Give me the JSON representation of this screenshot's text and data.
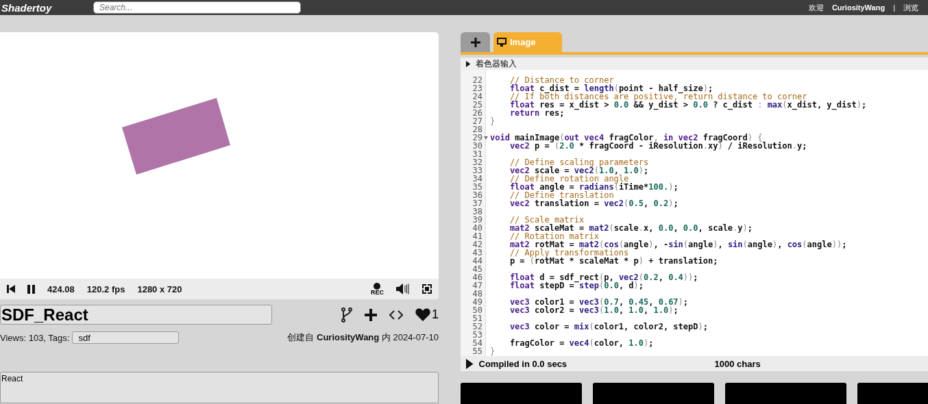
{
  "header": {
    "logo": "Shadertoy",
    "search": {
      "placeholder": "Search..."
    },
    "welcome": "欢迎",
    "user": "CuriosityWang",
    "separator": "|",
    "browse": "浏览"
  },
  "player": {
    "time": "424.08",
    "fps": "120.2 fps",
    "resolution": "1280 x 720",
    "rec": "REC"
  },
  "shader": {
    "title": "SDF_React",
    "views": "Views: 103, Tags:",
    "tags": "sdf",
    "created_prefix": "创建自",
    "author": "CuriosityWang",
    "created_mid": "内",
    "date": "2024-07-10",
    "likes": "1",
    "description": "React"
  },
  "editor": {
    "tabs": [
      {
        "kind": "add",
        "selected": false
      },
      {
        "label": "Image",
        "kind": "image",
        "selected": true
      }
    ],
    "inputs_label": "着色器输入",
    "lines": [
      {
        "n": "22",
        "fold": false,
        "s": [
          {
            "t": "    // Distance to corner",
            "kind": "comment"
          }
        ]
      },
      {
        "n": "23",
        "fold": false,
        "s": [
          {
            "t": "    float",
            "kind": "type"
          },
          {
            "t": " c_dist = ",
            "kind": "plain"
          },
          {
            "t": "length",
            "kind": "func"
          },
          {
            "t": "(",
            "kind": "punct"
          },
          {
            "t": "point - half_size",
            "kind": "plain"
          },
          {
            "t": ")",
            "kind": "punct"
          },
          {
            "t": ";",
            "kind": "plain"
          }
        ]
      },
      {
        "n": "24",
        "fold": false,
        "s": [
          {
            "t": "    // If both distances are positive, return distance to corner",
            "kind": "comment"
          }
        ]
      },
      {
        "n": "25",
        "fold": false,
        "s": [
          {
            "t": "    float",
            "kind": "type"
          },
          {
            "t": " res = x_dist > ",
            "kind": "plain"
          },
          {
            "t": "0.0",
            "kind": "number"
          },
          {
            "t": " && y_dist > ",
            "kind": "plain"
          },
          {
            "t": "0.0",
            "kind": "number"
          },
          {
            "t": " ? c_dist ",
            "kind": "plain"
          },
          {
            "t": ": ",
            "kind": "punct"
          },
          {
            "t": "max",
            "kind": "func"
          },
          {
            "t": "(",
            "kind": "punct"
          },
          {
            "t": "x_dist, y_dist",
            "kind": "plain"
          },
          {
            "t": ")",
            "kind": "punct"
          },
          {
            "t": ";",
            "kind": "plain"
          }
        ]
      },
      {
        "n": "26",
        "fold": false,
        "s": [
          {
            "t": "    return",
            "kind": "type"
          },
          {
            "t": " res;",
            "kind": "plain"
          }
        ]
      },
      {
        "n": "27",
        "fold": false,
        "s": [
          {
            "t": "}",
            "kind": "punct"
          }
        ]
      },
      {
        "n": "28",
        "fold": false
      },
      {
        "n": "29",
        "fold": true,
        "s": [
          {
            "t": "void",
            "kind": "type"
          },
          {
            "t": " mainImage",
            "kind": "plain"
          },
          {
            "t": "(",
            "kind": "punct"
          },
          {
            "t": "out vec4",
            "kind": "type"
          },
          {
            "t": " fragColor",
            "kind": "plain"
          },
          {
            "t": ", ",
            "kind": "punct"
          },
          {
            "t": "in vec2",
            "kind": "type"
          },
          {
            "t": " fragCoord",
            "kind": "plain"
          },
          {
            "t": ")",
            "kind": "punct"
          },
          {
            "t": " {",
            "kind": "punct"
          }
        ]
      },
      {
        "n": "30",
        "fold": false,
        "s": [
          {
            "t": "    vec2",
            "kind": "type"
          },
          {
            "t": " p = ",
            "kind": "plain"
          },
          {
            "t": "(",
            "kind": "punct"
          },
          {
            "t": "2.0",
            "kind": "number"
          },
          {
            "t": " * fragCoord - iResolution",
            "kind": "plain"
          },
          {
            "t": ".",
            "kind": "punct"
          },
          {
            "t": "xy",
            "kind": "plain"
          },
          {
            "t": ")",
            "kind": "punct"
          },
          {
            "t": " / iResolution",
            "kind": "plain"
          },
          {
            "t": ".",
            "kind": "punct"
          },
          {
            "t": "y;",
            "kind": "plain"
          }
        ]
      },
      {
        "n": "31",
        "fold": false
      },
      {
        "n": "32",
        "fold": false,
        "s": [
          {
            "t": "    // Define scaling parameters",
            "kind": "comment"
          }
        ]
      },
      {
        "n": "33",
        "fold": false,
        "s": [
          {
            "t": "    vec2",
            "kind": "type"
          },
          {
            "t": " scale = ",
            "kind": "plain"
          },
          {
            "t": "vec2",
            "kind": "func"
          },
          {
            "t": "(",
            "kind": "punct"
          },
          {
            "t": "1.0",
            "kind": "number"
          },
          {
            "t": ", ",
            "kind": "plain"
          },
          {
            "t": "1.0",
            "kind": "number"
          },
          {
            "t": ")",
            "kind": "punct"
          },
          {
            "t": ";",
            "kind": "plain"
          }
        ]
      },
      {
        "n": "34",
        "fold": false,
        "s": [
          {
            "t": "    // Define rotation angle",
            "kind": "comment"
          }
        ]
      },
      {
        "n": "35",
        "fold": false,
        "s": [
          {
            "t": "    float",
            "kind": "type"
          },
          {
            "t": " angle = ",
            "kind": "plain"
          },
          {
            "t": "radians",
            "kind": "func"
          },
          {
            "t": "(",
            "kind": "punct"
          },
          {
            "t": "iTime*",
            "kind": "plain"
          },
          {
            "t": "100.",
            "kind": "number"
          },
          {
            "t": ")",
            "kind": "punct"
          },
          {
            "t": ";",
            "kind": "plain"
          }
        ]
      },
      {
        "n": "36",
        "fold": false,
        "s": [
          {
            "t": "    // Define translation",
            "kind": "comment"
          }
        ]
      },
      {
        "n": "37",
        "fold": false,
        "s": [
          {
            "t": "    vec2",
            "kind": "type"
          },
          {
            "t": " translation = ",
            "kind": "plain"
          },
          {
            "t": "vec2",
            "kind": "func"
          },
          {
            "t": "(",
            "kind": "punct"
          },
          {
            "t": "0.5",
            "kind": "number"
          },
          {
            "t": ", ",
            "kind": "plain"
          },
          {
            "t": "0.2",
            "kind": "number"
          },
          {
            "t": ")",
            "kind": "punct"
          },
          {
            "t": ";",
            "kind": "plain"
          }
        ]
      },
      {
        "n": "38",
        "fold": false
      },
      {
        "n": "39",
        "fold": false,
        "s": [
          {
            "t": "    // Scale matrix",
            "kind": "comment"
          }
        ]
      },
      {
        "n": "40",
        "fold": false,
        "s": [
          {
            "t": "    mat2",
            "kind": "type"
          },
          {
            "t": " scaleMat = ",
            "kind": "plain"
          },
          {
            "t": "mat2",
            "kind": "func"
          },
          {
            "t": "(",
            "kind": "punct"
          },
          {
            "t": "scale",
            "kind": "plain"
          },
          {
            "t": ".",
            "kind": "punct"
          },
          {
            "t": "x, ",
            "kind": "plain"
          },
          {
            "t": "0.0",
            "kind": "number"
          },
          {
            "t": ", ",
            "kind": "plain"
          },
          {
            "t": "0.0",
            "kind": "number"
          },
          {
            "t": ", scale",
            "kind": "plain"
          },
          {
            "t": ".",
            "kind": "punct"
          },
          {
            "t": "y",
            "kind": "plain"
          },
          {
            "t": ")",
            "kind": "punct"
          },
          {
            "t": ";",
            "kind": "plain"
          }
        ]
      },
      {
        "n": "41",
        "fold": false,
        "s": [
          {
            "t": "    // Rotation matrix",
            "kind": "comment"
          }
        ]
      },
      {
        "n": "42",
        "fold": false,
        "s": [
          {
            "t": "    mat2",
            "kind": "type"
          },
          {
            "t": " rotMat = ",
            "kind": "plain"
          },
          {
            "t": "mat2",
            "kind": "func"
          },
          {
            "t": "(",
            "kind": "punct"
          },
          {
            "t": "cos",
            "kind": "func"
          },
          {
            "t": "(",
            "kind": "punct"
          },
          {
            "t": "angle",
            "kind": "plain"
          },
          {
            "t": ")",
            "kind": "punct"
          },
          {
            "t": ", -",
            "kind": "plain"
          },
          {
            "t": "sin",
            "kind": "func"
          },
          {
            "t": "(",
            "kind": "punct"
          },
          {
            "t": "angle",
            "kind": "plain"
          },
          {
            "t": ")",
            "kind": "punct"
          },
          {
            "t": ", ",
            "kind": "plain"
          },
          {
            "t": "sin",
            "kind": "func"
          },
          {
            "t": "(",
            "kind": "punct"
          },
          {
            "t": "angle",
            "kind": "plain"
          },
          {
            "t": ")",
            "kind": "punct"
          },
          {
            "t": ", ",
            "kind": "plain"
          },
          {
            "t": "cos",
            "kind": "func"
          },
          {
            "t": "(",
            "kind": "punct"
          },
          {
            "t": "angle",
            "kind": "plain"
          },
          {
            "t": "))",
            "kind": "punct"
          },
          {
            "t": ";",
            "kind": "plain"
          }
        ]
      },
      {
        "n": "43",
        "fold": false,
        "s": [
          {
            "t": "    // Apply transformations",
            "kind": "comment"
          }
        ]
      },
      {
        "n": "44",
        "fold": false,
        "s": [
          {
            "t": "    p = ",
            "kind": "plain"
          },
          {
            "t": "(",
            "kind": "punct"
          },
          {
            "t": "rotMat * scaleMat * p",
            "kind": "plain"
          },
          {
            "t": ")",
            "kind": "punct"
          },
          {
            "t": " + translation;",
            "kind": "plain"
          }
        ]
      },
      {
        "n": "45",
        "fold": false
      },
      {
        "n": "46",
        "fold": false,
        "s": [
          {
            "t": "    float",
            "kind": "type"
          },
          {
            "t": " d = sdf_rect",
            "kind": "plain"
          },
          {
            "t": "(",
            "kind": "punct"
          },
          {
            "t": "p, ",
            "kind": "plain"
          },
          {
            "t": "vec2",
            "kind": "func"
          },
          {
            "t": "(",
            "kind": "punct"
          },
          {
            "t": "0.2",
            "kind": "number"
          },
          {
            "t": ", ",
            "kind": "plain"
          },
          {
            "t": "0.4",
            "kind": "number"
          },
          {
            "t": "))",
            "kind": "punct"
          },
          {
            "t": ";",
            "kind": "plain"
          }
        ]
      },
      {
        "n": "47",
        "fold": false,
        "s": [
          {
            "t": "    float",
            "kind": "type"
          },
          {
            "t": " stepD = ",
            "kind": "plain"
          },
          {
            "t": "step",
            "kind": "func"
          },
          {
            "t": "(",
            "kind": "punct"
          },
          {
            "t": "0.0",
            "kind": "number"
          },
          {
            "t": ", d",
            "kind": "plain"
          },
          {
            "t": ")",
            "kind": "punct"
          },
          {
            "t": ";",
            "kind": "plain"
          }
        ]
      },
      {
        "n": "48",
        "fold": false
      },
      {
        "n": "49",
        "fold": false,
        "s": [
          {
            "t": "    vec3",
            "kind": "type"
          },
          {
            "t": " color1 = ",
            "kind": "plain"
          },
          {
            "t": "vec3",
            "kind": "func"
          },
          {
            "t": "(",
            "kind": "punct"
          },
          {
            "t": "0.7",
            "kind": "number"
          },
          {
            "t": ", ",
            "kind": "plain"
          },
          {
            "t": "0.45",
            "kind": "number"
          },
          {
            "t": ", ",
            "kind": "plain"
          },
          {
            "t": "0.67",
            "kind": "number"
          },
          {
            "t": ")",
            "kind": "punct"
          },
          {
            "t": ";",
            "kind": "plain"
          }
        ]
      },
      {
        "n": "50",
        "fold": false,
        "s": [
          {
            "t": "    vec3",
            "kind": "type"
          },
          {
            "t": " color2 = ",
            "kind": "plain"
          },
          {
            "t": "vec3",
            "kind": "func"
          },
          {
            "t": "(",
            "kind": "punct"
          },
          {
            "t": "1.0",
            "kind": "number"
          },
          {
            "t": ", ",
            "kind": "plain"
          },
          {
            "t": "1.0",
            "kind": "number"
          },
          {
            "t": ", ",
            "kind": "plain"
          },
          {
            "t": "1.0",
            "kind": "number"
          },
          {
            "t": ")",
            "kind": "punct"
          },
          {
            "t": ";",
            "kind": "plain"
          }
        ]
      },
      {
        "n": "51",
        "fold": false
      },
      {
        "n": "52",
        "fold": false,
        "s": [
          {
            "t": "    vec3",
            "kind": "type"
          },
          {
            "t": " color = ",
            "kind": "plain"
          },
          {
            "t": "mix",
            "kind": "func"
          },
          {
            "t": "(",
            "kind": "punct"
          },
          {
            "t": "color1, color2, stepD",
            "kind": "plain"
          },
          {
            "t": ")",
            "kind": "punct"
          },
          {
            "t": ";",
            "kind": "plain"
          }
        ]
      },
      {
        "n": "53",
        "fold": false
      },
      {
        "n": "54",
        "fold": false,
        "s": [
          {
            "t": "    fragColor = ",
            "kind": "plain"
          },
          {
            "t": "vec4",
            "kind": "func"
          },
          {
            "t": "(",
            "kind": "punct"
          },
          {
            "t": "color, ",
            "kind": "plain"
          },
          {
            "t": "1.0",
            "kind": "number"
          },
          {
            "t": ")",
            "kind": "punct"
          },
          {
            "t": ";",
            "kind": "plain"
          }
        ]
      },
      {
        "n": "55",
        "fold": false,
        "s": [
          {
            "t": "}",
            "kind": "punct"
          }
        ]
      }
    ],
    "status": "Compiled in 0.0 secs",
    "chars": "1000 chars"
  },
  "thumbnails": [
    {
      "kind": "preview"
    },
    {
      "kind": "preview"
    },
    {
      "kind": "preview"
    },
    {
      "kind": "preview"
    }
  ]
}
